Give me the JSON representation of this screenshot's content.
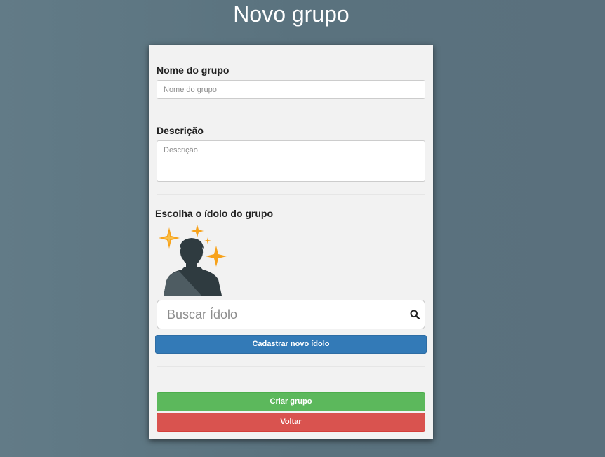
{
  "page": {
    "title": "Novo grupo"
  },
  "form": {
    "name": {
      "label": "Nome do grupo",
      "placeholder": "Nome do grupo",
      "value": ""
    },
    "description": {
      "label": "Descrição",
      "placeholder": "Descrição",
      "value": ""
    },
    "idol": {
      "label": "Escolha o ídolo do grupo",
      "image_icon": "idol-placeholder-silhouette-with-sparkles-icon",
      "search_placeholder": "Buscar Ídolo",
      "search_value": "",
      "search_icon": "search-icon",
      "register_button_label": "Cadastrar novo ídolo"
    },
    "actions": {
      "create_label": "Criar grupo",
      "back_label": "Voltar"
    }
  },
  "colors": {
    "background": "#5e7681",
    "card_background": "#f2f2f2",
    "primary": "#337ab7",
    "success": "#5cb85c",
    "danger": "#d9534f",
    "sparkle": "#f7a21b"
  }
}
